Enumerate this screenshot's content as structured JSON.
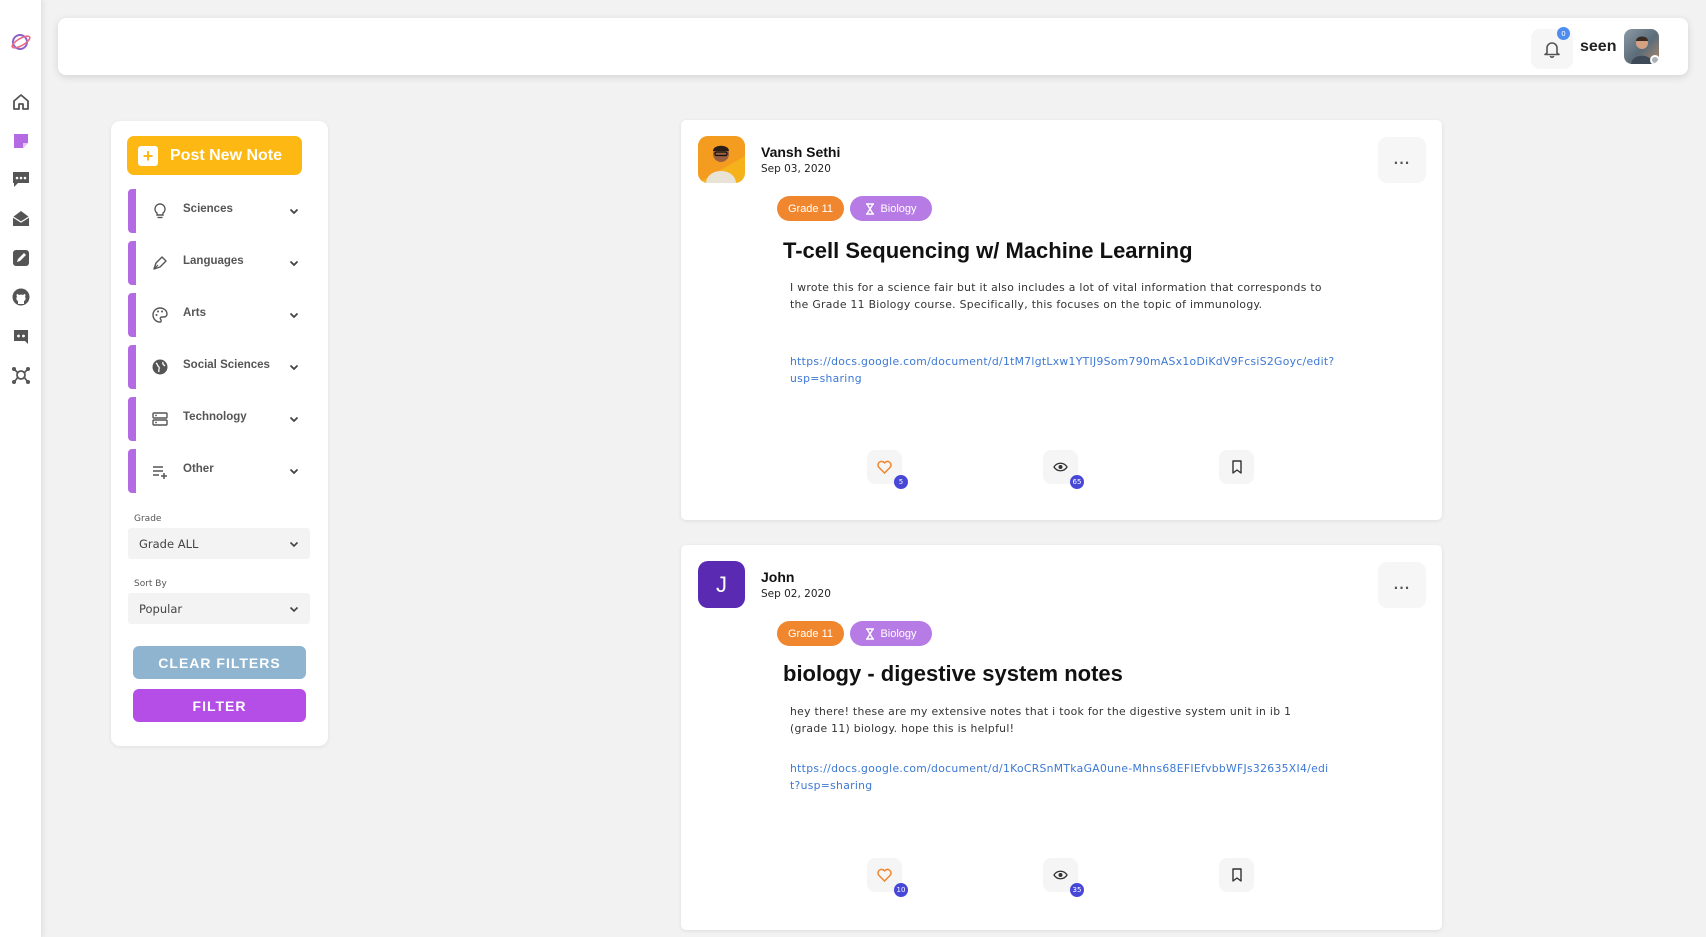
{
  "header": {
    "notification_count": "0",
    "username": "seen"
  },
  "rail": {
    "icons": [
      "logo-icon",
      "home-icon",
      "notes-icon",
      "chat-icon",
      "inbox-icon",
      "edit-icon",
      "github-icon",
      "discord-icon",
      "network-icon"
    ]
  },
  "sidebar": {
    "post_label": "Post New Note",
    "categories": [
      {
        "label": "Sciences",
        "icon": "lightbulb-icon"
      },
      {
        "label": "Languages",
        "icon": "pen-icon"
      },
      {
        "label": "Arts",
        "icon": "palette-icon"
      },
      {
        "label": "Social Sciences",
        "icon": "globe-icon"
      },
      {
        "label": "Technology",
        "icon": "server-icon"
      },
      {
        "label": "Other",
        "icon": "playlist-add-icon"
      }
    ],
    "grade_label": "Grade",
    "grade_value": "Grade ALL",
    "sort_label": "Sort By",
    "sort_value": "Popular",
    "clear_label": "CLEAR FILTERS",
    "filter_label": "FILTER"
  },
  "posts": [
    {
      "author": "Vansh Sethi",
      "date": "Sep 03, 2020",
      "grade_tag": "Grade 11",
      "subject_tag": "Biology",
      "title": "T-cell Sequencing w/ Machine Learning",
      "description": "I wrote this for a science fair but it also includes a lot of vital information that corresponds to the Grade 11 Biology course. Specifically, this focuses on the topic of immunology.",
      "link": "https://docs.google.com/document/d/1tM7lgtLxw1YTIJ9Som790mASx1oDiKdV9FcsiS2Goyc/edit?usp=sharing",
      "likes": "5",
      "views": "65",
      "more": "..."
    },
    {
      "author": "John",
      "avatar_letter": "J",
      "date": "Sep 02, 2020",
      "grade_tag": "Grade 11",
      "subject_tag": "Biology",
      "title": "biology - digestive system notes",
      "description": "hey there! these are my extensive notes that i took for the digestive system unit in ib 1 (grade 11) biology. hope this is helpful!",
      "link": "https://docs.google.com/document/d/1KoCRSnMTkaGA0une-Mhns68EFIEfvbbWFJs32635XI4/edit?usp=sharing",
      "likes": "10",
      "views": "35",
      "more": "..."
    }
  ],
  "colors": {
    "accent_purple": "#b36ae2",
    "post_yellow": "#fdb813",
    "grade_orange": "#f0862e",
    "subject_purple": "#b77be6",
    "clear_blue": "#8fb4d0",
    "filter_purple": "#b54ee6"
  }
}
